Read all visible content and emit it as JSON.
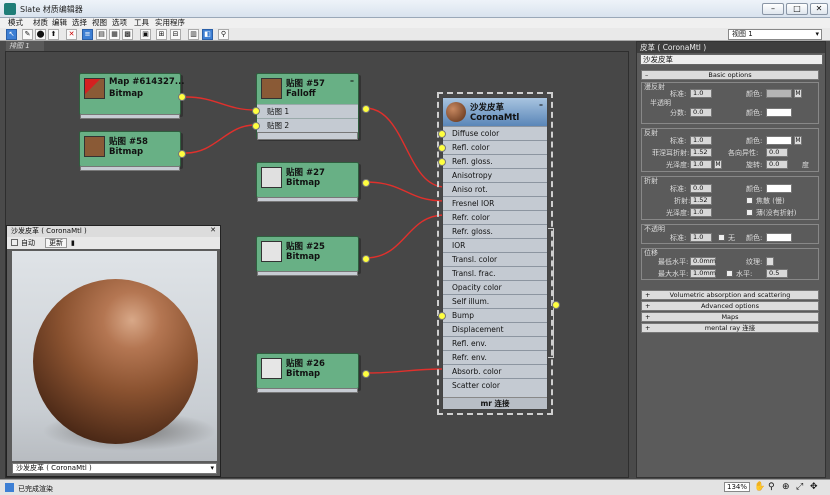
{
  "window": {
    "title": "Slate 材质编辑器"
  },
  "menu": [
    "模式",
    "材质",
    "编辑",
    "选择",
    "视图",
    "选项",
    "工具",
    "实用程序"
  ],
  "toolbar": {
    "view_select": "视图 1"
  },
  "view_tab": "排图 1",
  "nodes": [
    {
      "title": "Map #614327...",
      "type": "Bitmap"
    },
    {
      "title": "贴图 #58",
      "type": "Bitmap"
    },
    {
      "title": "贴图 #57",
      "type": "Falloff",
      "slots": [
        "贴图 1",
        "贴图 2"
      ]
    },
    {
      "title": "贴图 #27",
      "type": "Bitmap"
    },
    {
      "title": "贴图 #25",
      "type": "Bitmap"
    },
    {
      "title": "贴图 #26",
      "type": "Bitmap"
    }
  ],
  "material": {
    "title": "沙发皮革",
    "type": "CoronaMtl",
    "slots": [
      "Diffuse color",
      "Refl. color",
      "Refl. gloss.",
      "Anisotropy",
      "Aniso rot.",
      "Fresnel IOR",
      "Refr. color",
      "Refr. gloss.",
      "IOR",
      "Transl. color",
      "Transl. frac.",
      "Opacity color",
      "Self illum.",
      "Bump",
      "Displacement",
      "Refl. env.",
      "Refr. env.",
      "Absorb. color",
      "Scatter color"
    ],
    "footer": "mr 连接"
  },
  "preview": {
    "header": "沙发皮革 ( CoronaMtl )",
    "auto_label": "自动",
    "update_label": "更新",
    "selector": "沙发皮革 ( CoronaMtl )"
  },
  "panel": {
    "header": "皮革 ( CoronaMtl )",
    "name": "沙发皮革",
    "basic_options": "Basic options",
    "diffuse": {
      "label": "漫反射",
      "level_label": "标准:",
      "level": "1.0",
      "color_label": "颜色:",
      "m": "M"
    },
    "translucency": {
      "label": "半透明",
      "frac_label": "分数:",
      "frac": "0.0",
      "color_label": "颜色:"
    },
    "reflection": {
      "label": "反射",
      "level_label": "标准:",
      "level": "1.0",
      "color_label": "颜色:",
      "m": "M",
      "fresnel_label": "菲涅耳折射:",
      "fresnel": "1.52",
      "aniso_label": "各向异性:",
      "aniso": "0.0",
      "gloss_label": "光泽度:",
      "gloss": "1.0",
      "rot_label": "旋转:",
      "rot": "0.0",
      "deg": "度"
    },
    "refraction": {
      "label": "折射",
      "level_label": "标准:",
      "level": "0.0",
      "color_label": "颜色:",
      "ior_label": "折射:",
      "ior": "1.52",
      "caustics": "焦散 (慢)",
      "gloss_label": "光泽度:",
      "gloss": "1.0",
      "thin": "薄(没有折射)"
    },
    "opacity": {
      "label": "不透明",
      "level_label": "标准:",
      "level": "1.0",
      "m": "无",
      "color_label": "颜色:"
    },
    "displacement": {
      "label": "位移",
      "min_label": "最低水平:",
      "min": "0.0mm",
      "tex_label": "纹理:",
      "max_label": "最大水平:",
      "max": "1.0mm",
      "water_label": "水平:",
      "water": "0.5"
    },
    "rollouts": [
      "Volumetric absorption and scattering",
      "Advanced options",
      "Maps",
      "mental ray 连接"
    ]
  },
  "status": {
    "text": "已完成渲染",
    "zoom": "134%"
  },
  "colors": {
    "node_green": "#68b085",
    "material_header": "#5a86b8",
    "wire": "#e0302c",
    "socket": "#ffff40"
  }
}
